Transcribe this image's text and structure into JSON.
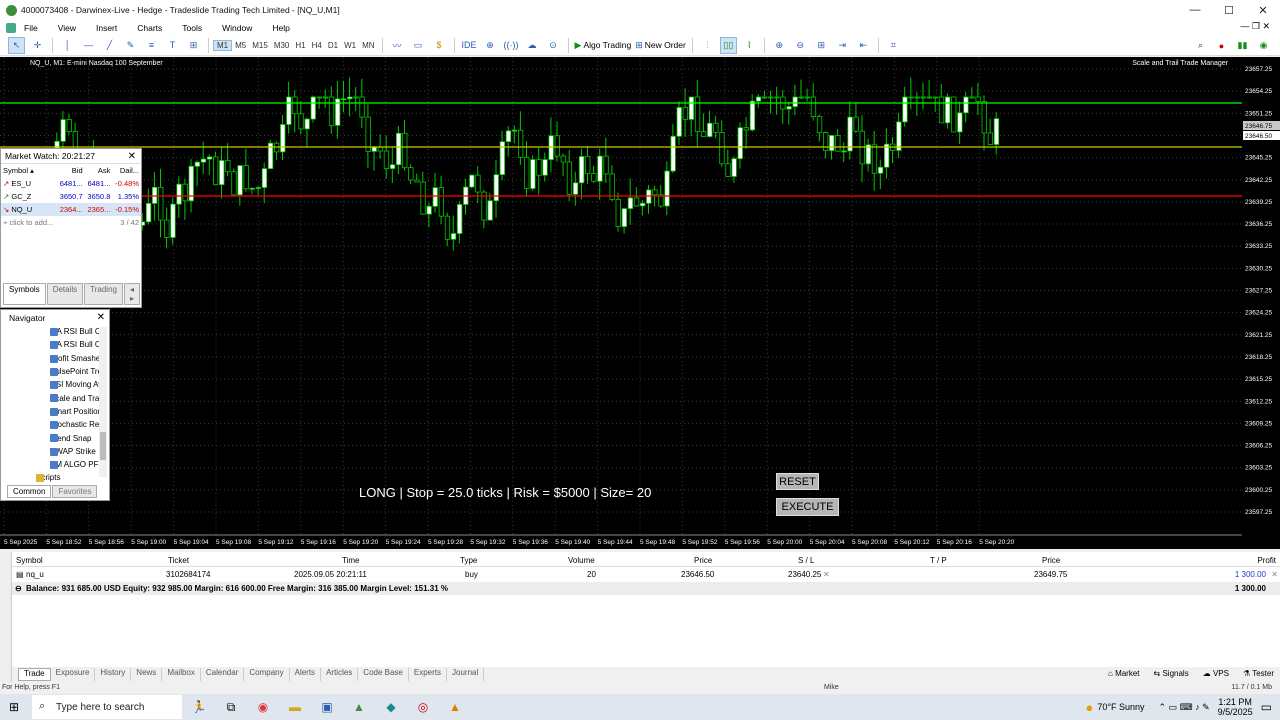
{
  "window": {
    "title": "4000073408 - Darwinex-Live - Hedge - Tradeslide Trading Tech Limited - [NQ_U,M1]"
  },
  "menu": [
    "File",
    "View",
    "Insert",
    "Charts",
    "Tools",
    "Window",
    "Help"
  ],
  "toolbar": {
    "timeframes": [
      "M1",
      "M5",
      "M15",
      "M30",
      "H1",
      "H4",
      "D1",
      "W1",
      "MN"
    ],
    "active_tf": "M1",
    "algo_label": "Algo Trading",
    "neworder_label": "New Order"
  },
  "chart": {
    "title": "NQ_U, M1: E-mini Nasdaq 100 September",
    "expert": "Scale and Trail Trade Manager",
    "info": "LONG | Stop = 25.0 ticks | Risk = $5000 | Size= 20",
    "reset_label": "RESET",
    "execute_label": "EXECUTE",
    "price_marker": "23646.75",
    "price_marker2": "23646.50",
    "yticks": [
      "23657.25",
      "23654.25",
      "23651.25",
      "23648.25",
      "23645.25",
      "23642.25",
      "23639.25",
      "23636.25",
      "23633.25",
      "23630.25",
      "23627.25",
      "23624.25",
      "23621.25",
      "23618.25",
      "23615.25",
      "23612.25",
      "23609.25",
      "23606.25",
      "23603.25",
      "23600.25",
      "23597.25"
    ],
    "xticks": [
      "5 Sep 2025",
      "5 Sep 18:52",
      "5 Sep 18:56",
      "5 Sep 19:00",
      "5 Sep 19:04",
      "5 Sep 19:08",
      "5 Sep 19:12",
      "5 Sep 19:16",
      "5 Sep 19:20",
      "5 Sep 19:24",
      "5 Sep 19:28",
      "5 Sep 19:32",
      "5 Sep 19:36",
      "5 Sep 19:40",
      "5 Sep 19:44",
      "5 Sep 19:48",
      "5 Sep 19:52",
      "5 Sep 19:56",
      "5 Sep 20:00",
      "5 Sep 20:04",
      "5 Sep 20:08",
      "5 Sep 20:12",
      "5 Sep 20:16",
      "5 Sep 20:20"
    ],
    "colors": {
      "bull": "#ffffff",
      "bear": "#000000",
      "wick": "#00c800",
      "tp_line": "#00ff00",
      "entry_line": "#c8c800",
      "sl_line": "#ff0000"
    }
  },
  "market_watch": {
    "title": "Market Watch: 20:21:27",
    "headers": [
      "Symbol",
      "Bid",
      "Ask",
      "Dail..."
    ],
    "rows": [
      {
        "symbol": "ES_U",
        "bid": "6481...",
        "ask": "6481...",
        "daily": "-0.48%"
      },
      {
        "symbol": "GC_Z",
        "bid": "3650.7",
        "ask": "3650.8",
        "daily": "1.35%"
      },
      {
        "symbol": "NQ_U",
        "bid": "2364...",
        "ask": "2365...",
        "daily": "-0.15%"
      }
    ],
    "add_text": "click to add...",
    "count": "3 / 42",
    "tabs": [
      "Symbols",
      "Details",
      "Trading"
    ]
  },
  "navigator": {
    "title": "Navigator",
    "items": [
      "MA RSI Bull C",
      "MA RSI Bull C",
      "Profit Smashe",
      "PulsePoint Tre",
      "RSI Moving Av",
      "Scale and Trail",
      "Smart Position",
      "Stochastic Rev",
      "Trend Snap",
      "VWAP Strike",
      "YM ALGO PF",
      "Scripts"
    ],
    "tabs": [
      "Common",
      "Favorites"
    ]
  },
  "terminal": {
    "headers": [
      "Symbol",
      "Ticket",
      "Time",
      "Type",
      "Volume",
      "Price",
      "S / L",
      "T / P",
      "Price",
      "Profit"
    ],
    "position": {
      "symbol": "nq_u",
      "ticket": "3102684174",
      "time": "2025.09.05 20:21:11",
      "type": "buy",
      "volume": "20",
      "price": "23646.50",
      "sl": "23640.25",
      "tp": "",
      "current": "23649.75",
      "profit": "1 300.00"
    },
    "balance_text": "Balance: 931 685.00 USD  Equity: 932 985.00  Margin: 616 600.00  Free Margin: 316 385.00  Margin Level: 151.31 %",
    "balance_profit": "1 300.00",
    "tabs": [
      "Trade",
      "Exposure",
      "History",
      "News",
      "Mailbox",
      "Calendar",
      "Company",
      "Alerts",
      "Articles",
      "Code Base",
      "Experts",
      "Journal"
    ],
    "right_tabs": [
      "Market",
      "Signals",
      "VPS",
      "Tester"
    ]
  },
  "status": {
    "help": "For Help, press F1",
    "user": "Mike",
    "net": "11.7 / 0.1 Mb"
  },
  "taskbar": {
    "search": "Type here to search",
    "weather": "70°F  Sunny",
    "time": "1:21 PM",
    "date": "9/5/2025"
  }
}
